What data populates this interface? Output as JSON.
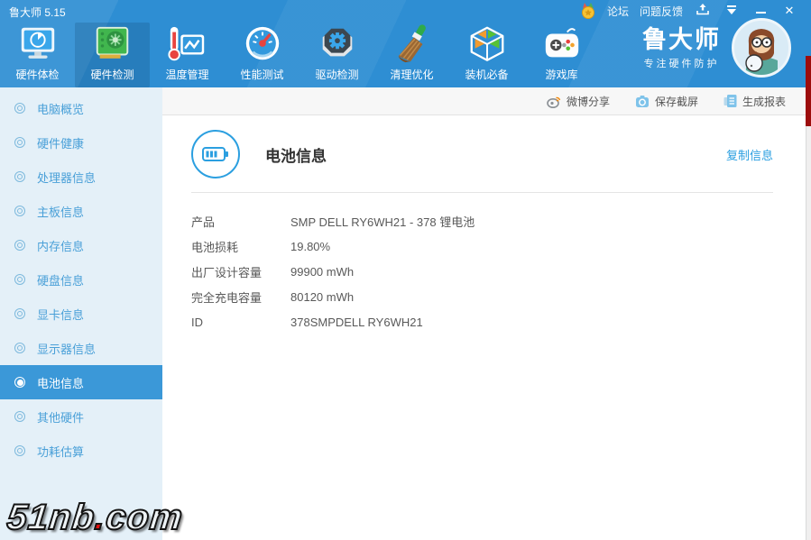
{
  "titlebar": {
    "title": "鲁大师 5.15",
    "links": [
      {
        "label": "论坛"
      },
      {
        "label": "问题反馈"
      }
    ],
    "minimize_label": "–",
    "close_label": "✕"
  },
  "nav": {
    "tabs": [
      {
        "label": "硬件体检",
        "selected": false
      },
      {
        "label": "硬件检测",
        "selected": true
      },
      {
        "label": "温度管理",
        "selected": false
      },
      {
        "label": "性能测试",
        "selected": false
      },
      {
        "label": "驱动检测",
        "selected": false
      },
      {
        "label": "清理优化",
        "selected": false
      },
      {
        "label": "装机必备",
        "selected": false
      },
      {
        "label": "游戏库",
        "selected": false
      }
    ],
    "brand": {
      "name": "鲁大师",
      "slogan": "专注硬件防护"
    }
  },
  "sidebar": {
    "items": [
      {
        "label": "电脑概览",
        "selected": false
      },
      {
        "label": "硬件健康",
        "selected": false
      },
      {
        "label": "处理器信息",
        "selected": false
      },
      {
        "label": "主板信息",
        "selected": false
      },
      {
        "label": "内存信息",
        "selected": false
      },
      {
        "label": "硬盘信息",
        "selected": false
      },
      {
        "label": "显卡信息",
        "selected": false
      },
      {
        "label": "显示器信息",
        "selected": false
      },
      {
        "label": "电池信息",
        "selected": true
      },
      {
        "label": "其他硬件",
        "selected": false
      },
      {
        "label": "功耗估算",
        "selected": false
      }
    ]
  },
  "toolbar": {
    "actions": [
      {
        "label": "微博分享",
        "icon": "weibo-icon"
      },
      {
        "label": "保存截屏",
        "icon": "camera-icon"
      },
      {
        "label": "生成报表",
        "icon": "report-icon"
      }
    ]
  },
  "content": {
    "title": "电池信息",
    "copy_link": "复制信息",
    "rows": [
      {
        "label": "产品",
        "value": "SMP DELL RY6WH21 - 378 锂电池"
      },
      {
        "label": "电池损耗",
        "value": "19.80%"
      },
      {
        "label": "出厂设计容量",
        "value": "99900 mWh"
      },
      {
        "label": "完全充电容量",
        "value": "80120 mWh"
      },
      {
        "label": "ID",
        "value": "378SMPDELL RY6WH21"
      }
    ]
  },
  "watermark": {
    "prefix": "51nb",
    "dot": ".",
    "suffix": "com"
  },
  "colors": {
    "header_blue": "#2e8ed3",
    "sidebar_bg": "#e4f0f8",
    "sidebar_selected": "#3b98d8",
    "link_blue": "#2b9fe0",
    "sliver_red": "#9d0d0d"
  }
}
